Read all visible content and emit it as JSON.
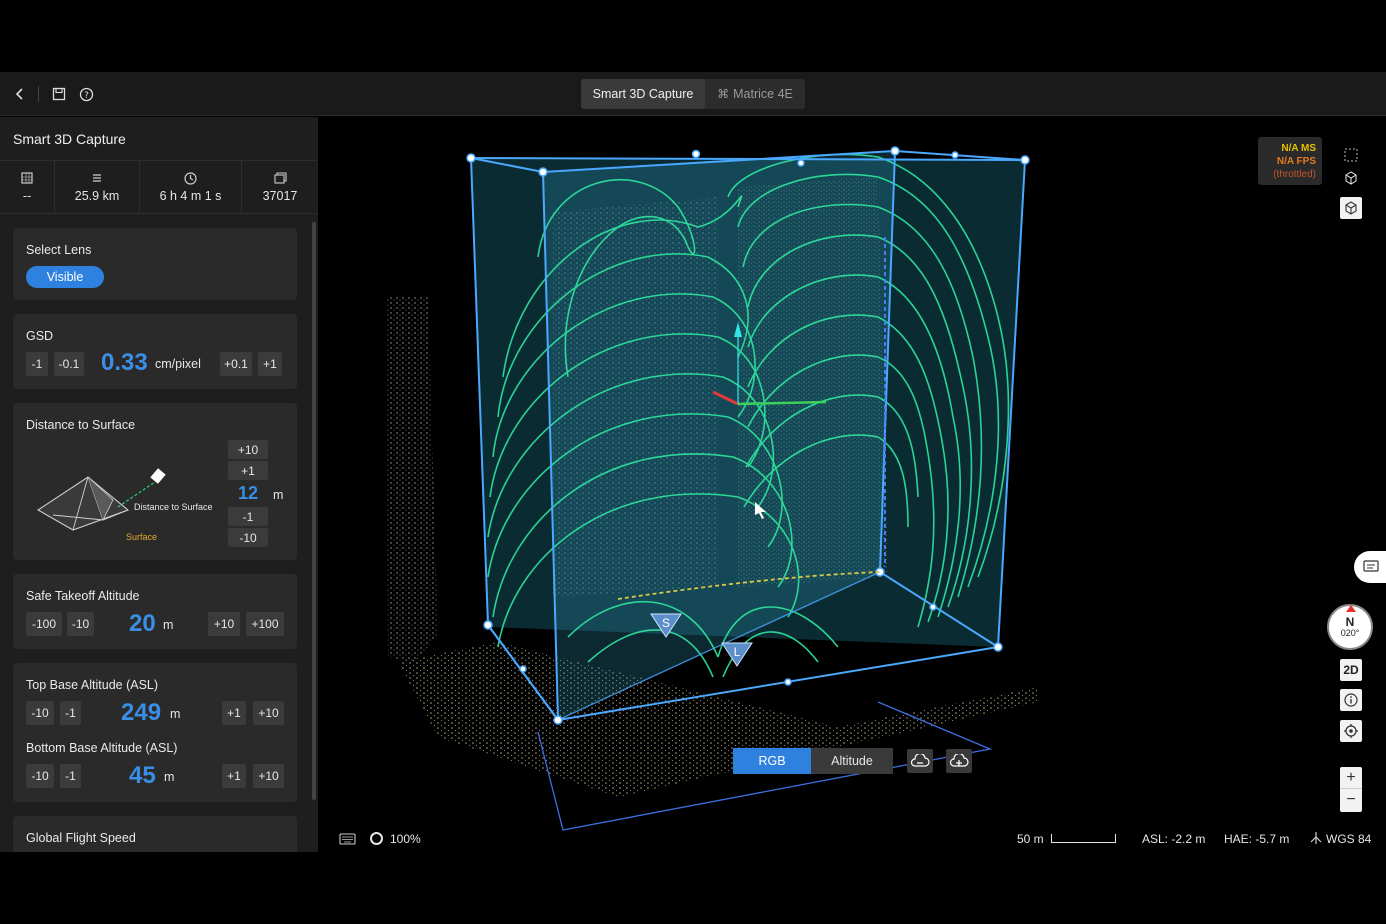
{
  "toolbar": {
    "tabs": [
      {
        "label": "Smart 3D Capture",
        "active": true
      },
      {
        "label": "Matrice 4E",
        "active": false
      }
    ],
    "icons": [
      "back-icon",
      "save-icon",
      "help-icon"
    ]
  },
  "sidebar": {
    "title": "Smart 3D Capture",
    "stats": [
      {
        "icon": "area-icon",
        "value": "--"
      },
      {
        "icon": "distance-icon",
        "value": "25.9 km"
      },
      {
        "icon": "clock-icon",
        "value": "6 h 4 m 1 s"
      },
      {
        "icon": "photos-icon",
        "value": "37017"
      }
    ],
    "lens": {
      "label": "Select Lens",
      "selected": "Visible"
    },
    "gsd": {
      "label": "GSD",
      "minus_buttons": [
        "-1",
        "-0.1"
      ],
      "value": "0.33",
      "unit": "cm/pixel",
      "plus_buttons": [
        "+0.1",
        "+1"
      ]
    },
    "distance": {
      "label": "Distance to Surface",
      "diagram_distance_label": "Distance to Surface",
      "diagram_surface_label": "Surface",
      "plus_buttons": [
        "+10",
        "+1"
      ],
      "value": "12",
      "unit": "m",
      "minus_buttons": [
        "-1",
        "-10"
      ]
    },
    "takeoff": {
      "label": "Safe Takeoff Altitude",
      "minus_buttons": [
        "-100",
        "-10"
      ],
      "value": "20",
      "unit": "m",
      "plus_buttons": [
        "+10",
        "+100"
      ]
    },
    "top_base": {
      "label": "Top Base Altitude (ASL)",
      "minus_buttons": [
        "-10",
        "-1"
      ],
      "value": "249",
      "unit": "m",
      "plus_buttons": [
        "+1",
        "+10"
      ]
    },
    "bottom_base": {
      "label": "Bottom Base Altitude (ASL)",
      "minus_buttons": [
        "-10",
        "-1"
      ],
      "value": "45",
      "unit": "m",
      "plus_buttons": [
        "+1",
        "+10"
      ]
    },
    "speed": {
      "label": "Global Flight Speed"
    }
  },
  "viewport": {
    "perf": {
      "ms": "N/A MS",
      "fps": "N/A FPS",
      "note": "(throttled)"
    },
    "markers": {
      "start": "S",
      "land": "L"
    },
    "color_modes": [
      {
        "label": "RGB",
        "active": true
      },
      {
        "label": "Altitude",
        "active": false
      }
    ],
    "compass": {
      "dir": "N",
      "heading": "020°"
    },
    "view_mode": "2D",
    "zoom": "100%",
    "scale": "50 m",
    "asl": "ASL: -2.2 m",
    "hae": "HAE: -5.7 m",
    "datum": "WGS 84",
    "colors": {
      "accent": "#2f81e0",
      "contour": "#2ee6a0",
      "box": "#4aa8ff",
      "warn_yellow": "#e6c200",
      "warn_orange": "#e87a1e"
    }
  }
}
